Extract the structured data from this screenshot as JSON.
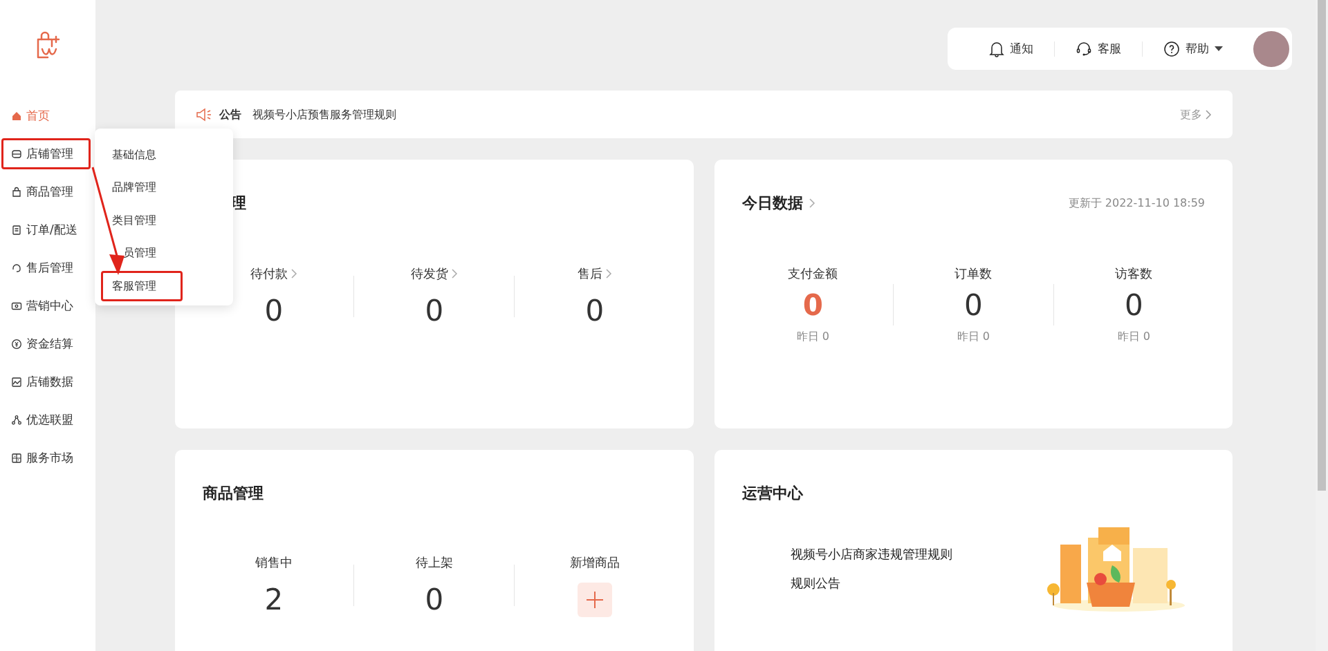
{
  "sidebar": {
    "items": [
      {
        "label": "首页",
        "selected": true,
        "highlighted": false
      },
      {
        "label": "店铺管理",
        "selected": false,
        "highlighted": true
      },
      {
        "label": "商品管理",
        "selected": false,
        "highlighted": false
      },
      {
        "label": "订单/配送",
        "selected": false,
        "highlighted": false
      },
      {
        "label": "售后管理",
        "selected": false,
        "highlighted": false
      },
      {
        "label": "营销中心",
        "selected": false,
        "highlighted": false
      },
      {
        "label": "资金结算",
        "selected": false,
        "highlighted": false
      },
      {
        "label": "店铺数据",
        "selected": false,
        "highlighted": false
      },
      {
        "label": "优选联盟",
        "selected": false,
        "highlighted": false
      },
      {
        "label": "服务市场",
        "selected": false,
        "highlighted": false
      }
    ]
  },
  "submenu": {
    "items": [
      {
        "label": "基础信息",
        "highlighted": false
      },
      {
        "label": "品牌管理",
        "highlighted": false
      },
      {
        "label": "类目管理",
        "highlighted": false
      },
      {
        "label": "员管理",
        "highlighted": false
      },
      {
        "label": "客服管理",
        "highlighted": true
      }
    ]
  },
  "annotation": {
    "arrow": true
  },
  "toolbar": [
    {
      "label": "通知",
      "dropdown": false
    },
    {
      "label": "客服",
      "dropdown": false
    },
    {
      "label": "帮助",
      "dropdown": true
    }
  ],
  "announcement": {
    "tag": "公告",
    "text": "视频号小店预售服务管理规则",
    "more": "更多"
  },
  "pending": {
    "title": "理",
    "stats": [
      {
        "label": "待付款",
        "value": "0"
      },
      {
        "label": "待发货",
        "value": "0"
      },
      {
        "label": "售后",
        "value": "0"
      }
    ]
  },
  "today": {
    "title": "今日数据",
    "updated": "更新于 2022-11-10 18:59",
    "stats": [
      {
        "label": "支付金额",
        "value": "0",
        "highlight": true,
        "yesterday": "昨日 0"
      },
      {
        "label": "订单数",
        "value": "0",
        "highlight": false,
        "yesterday": "昨日 0"
      },
      {
        "label": "访客数",
        "value": "0",
        "highlight": false,
        "yesterday": "昨日 0"
      }
    ]
  },
  "products": {
    "title": "商品管理",
    "stats": [
      {
        "kind": "number",
        "label": "销售中",
        "value": "2"
      },
      {
        "kind": "number",
        "label": "待上架",
        "value": "0"
      },
      {
        "kind": "add",
        "label": "新增商品"
      }
    ]
  },
  "operations": {
    "title": "运营中心",
    "lines": [
      "视频号小店商家违规管理规则",
      "规则公告"
    ]
  }
}
